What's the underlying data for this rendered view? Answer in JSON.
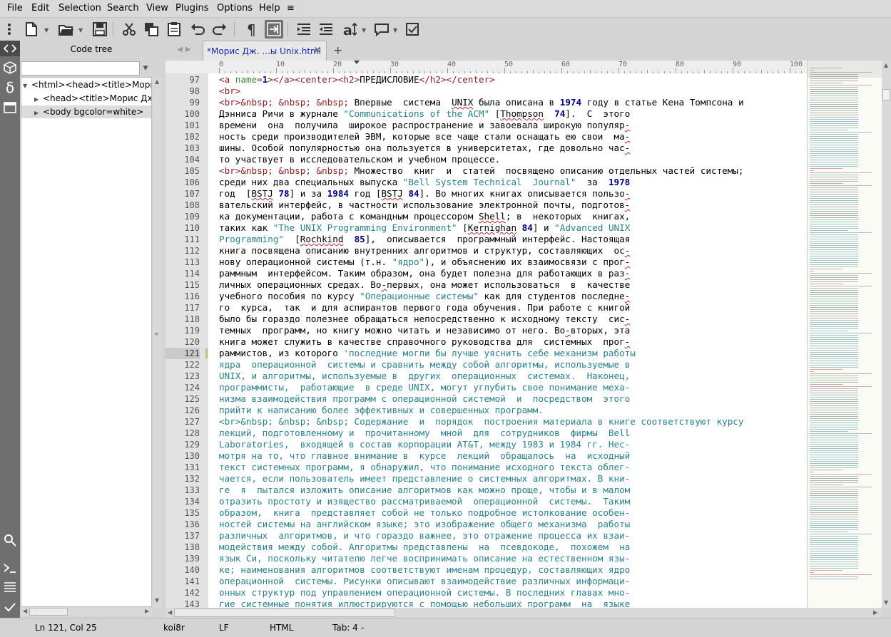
{
  "menu": [
    "File",
    "Edit",
    "Selection",
    "Search",
    "View",
    "Plugins",
    "Options",
    "Help",
    "≡"
  ],
  "sidebar": {
    "title": "Code tree",
    "filter_value": "",
    "tree": [
      {
        "label": "<html><head><title>Морис Дж",
        "expanded": true
      },
      {
        "label": "<head><title>Морис Дж. Ба",
        "expanded": false
      },
      {
        "label": "<body bgcolor=white>",
        "expanded": false
      }
    ]
  },
  "tab": {
    "label": "*Морис Дж. ...ы Unix.html",
    "close": "✕",
    "new": "+"
  },
  "ruler": [
    "0",
    "10",
    "20",
    "30",
    "40",
    "50",
    "60",
    "70",
    "80",
    "90",
    "100"
  ],
  "editor": {
    "first_line": 97,
    "current_line": 121,
    "lines": [
      [
        [
          "tag",
          "<a "
        ],
        [
          "attr",
          "name"
        ],
        [
          "tag",
          "="
        ],
        [
          "num",
          "1"
        ],
        [
          "tag",
          "></a><center><h2>"
        ],
        [
          "t",
          "ПРЕДИСЛОВИЕ"
        ],
        [
          "tag",
          "</h2></center>"
        ]
      ],
      [
        [
          "tag",
          "<br>"
        ]
      ],
      [
        [
          "tag",
          "<br>"
        ],
        [
          "ent",
          "&nbsp; &nbsp; &nbsp;"
        ],
        [
          "t",
          " Впервые  система  "
        ],
        [
          "sp",
          "UNIX"
        ],
        [
          "t",
          " была описана в "
        ],
        [
          "num",
          "1974"
        ],
        [
          "t",
          " году в статье Кена Томпсона и"
        ]
      ],
      [
        [
          "t",
          "Дэнниса Ричи в журнале "
        ],
        [
          "str",
          "\"Communications of the ACM\""
        ],
        [
          "t",
          " ["
        ],
        [
          "sp",
          "Thompson"
        ],
        [
          "t",
          "  "
        ],
        [
          "num",
          "74"
        ],
        [
          "t",
          "].  С  этого"
        ]
      ],
      [
        [
          "t",
          "времени  она  получила  широкое распространение и завоевала широкую популяр"
        ],
        [
          "sp",
          "-"
        ]
      ],
      [
        [
          "t",
          "ность среди производителей ЭВМ, которые все чаще стали оснащать ею свои  ма"
        ],
        [
          "sp",
          "-"
        ]
      ],
      [
        [
          "t",
          "шины. Особой популярностью она пользуется в университетах, где довольно час"
        ],
        [
          "sp",
          "-"
        ]
      ],
      [
        [
          "t",
          "то участвует в исследовательском и учебном процессе."
        ]
      ],
      [
        [
          "tag",
          "<br>"
        ],
        [
          "ent",
          "&nbsp; &nbsp; &nbsp;"
        ],
        [
          "t",
          " Множество  книг  и  статей  посвящено описанию отдельных частей системы;"
        ]
      ],
      [
        [
          "t",
          "среди них два специальных выпуска "
        ],
        [
          "str",
          "\"Bell System Technical  Journal\""
        ],
        [
          "t",
          "  за  "
        ],
        [
          "num",
          "1978"
        ]
      ],
      [
        [
          "t",
          "год  ["
        ],
        [
          "sp",
          "BSTJ"
        ],
        [
          "t",
          " "
        ],
        [
          "num",
          "78"
        ],
        [
          "t",
          "] и за "
        ],
        [
          "num",
          "1984"
        ],
        [
          "t",
          " год ["
        ],
        [
          "sp",
          "BSTJ"
        ],
        [
          "t",
          " "
        ],
        [
          "num",
          "84"
        ],
        [
          "t",
          "]. Во многих книгах описывается пользо"
        ],
        [
          "sp",
          "-"
        ]
      ],
      [
        [
          "t",
          "вательский интерфейс, в частности использование электронной почты, подготов"
        ],
        [
          "sp",
          "-"
        ]
      ],
      [
        [
          "t",
          "ка документации, работа с командным процессором "
        ],
        [
          "sp",
          "Shell"
        ],
        [
          "t",
          "; в  некоторых  книгах,"
        ]
      ],
      [
        [
          "t",
          "таких как "
        ],
        [
          "str",
          "\"The UNIX Programming Environment\""
        ],
        [
          "t",
          " ["
        ],
        [
          "sp",
          "Kernighan"
        ],
        [
          "t",
          " "
        ],
        [
          "num",
          "84"
        ],
        [
          "t",
          "] и "
        ],
        [
          "str",
          "\"Advanced UNIX"
        ]
      ],
      [
        [
          "str",
          "Programming\""
        ],
        [
          "t",
          "  ["
        ],
        [
          "sp",
          "Rochkind"
        ],
        [
          "t",
          "  "
        ],
        [
          "num",
          "85"
        ],
        [
          "t",
          "],  описывается  программный интерфейс. Настоящая"
        ]
      ],
      [
        [
          "t",
          "книга посвящена описанию внутренних алгоритмов и структур, составляющих  ос"
        ],
        [
          "sp",
          "-"
        ]
      ],
      [
        [
          "t",
          "нову операционной системы (т.н. "
        ],
        [
          "str",
          "\"ядро\""
        ],
        [
          "t",
          "), и объяснению их взаимосвязи с прог"
        ],
        [
          "sp",
          "-"
        ]
      ],
      [
        [
          "t",
          "раммным  интерфейсом. Таким образом, она будет полезна для работающих в раз"
        ],
        [
          "sp",
          "-"
        ]
      ],
      [
        [
          "t",
          "личных операционных средах. Во"
        ],
        [
          "sp",
          "-"
        ],
        [
          "t",
          "первых, она может использоваться  в  качестве"
        ]
      ],
      [
        [
          "t",
          "учебного пособия по курсу "
        ],
        [
          "str",
          "\"Операционные системы\""
        ],
        [
          "t",
          " как для студентов последне"
        ],
        [
          "sp",
          "-"
        ]
      ],
      [
        [
          "t",
          "го  курса,  так  и для аспирантов первого года обучения. При работе с книгой"
        ]
      ],
      [
        [
          "t",
          "было бы гораздо полезнее обращаться непосредственно к исходному тексту  сис"
        ],
        [
          "sp",
          "-"
        ]
      ],
      [
        [
          "t",
          "темных  программ, но книгу можно читать и независимо от него. Во"
        ],
        [
          "sp",
          "-"
        ],
        [
          "t",
          "вторых, эта"
        ]
      ],
      [
        [
          "t",
          "книга может служить в качестве справочного руководства для  системных  прог"
        ],
        [
          "sp",
          "-"
        ]
      ],
      [
        [
          "t",
          "раммистов, из которого "
        ],
        [
          "str",
          "'последние могли бы лучше уяснить себе механизм работы"
        ]
      ],
      [
        [
          "str",
          "ядра  операционной  системы и сравнить между собой алгоритмы, используемые в"
        ]
      ],
      [
        [
          "str",
          "UNIX, и алгоритмы, используемые в  других  операционных  системах.  Наконец,"
        ]
      ],
      [
        [
          "str",
          "программисты,  работающие  в среде UNIX, могут углубить свое понимание меха-"
        ]
      ],
      [
        [
          "str",
          "низма взаимодействия программ с операционной системой  и  посредством  этого"
        ]
      ],
      [
        [
          "str",
          "прийти к написанию более эффективных и совершенных программ."
        ]
      ],
      [
        [
          "str",
          "<br>&nbsp; &nbsp; &nbsp; Содержание  и  порядок  построения материала в книге соответствуют курсу"
        ]
      ],
      [
        [
          "str",
          "лекций, подготовленному и  прочитанному  мной  для  сотрудников  фирмы  Bell"
        ]
      ],
      [
        [
          "str",
          "Laboratories,  входящей в состав корпорации AT&T, между 1983 и 1984 гг. Нес-"
        ]
      ],
      [
        [
          "str",
          "мотря на то, что главное внимание в  курсе  лекций  обращалось  на  исходный"
        ]
      ],
      [
        [
          "str",
          "текст системных программ, я обнаружил, что понимание исходного текста облег-"
        ]
      ],
      [
        [
          "str",
          "чается, если пользователь имеет представление о системных алгоритмах. В кни-"
        ]
      ],
      [
        [
          "str",
          "ге  я  пытался изложить описание алгоритмов как можно проще, чтобы и в малом"
        ]
      ],
      [
        [
          "str",
          "отразить простоту и изящество рассматриваемой  операционной  системы.  Таким"
        ]
      ],
      [
        [
          "str",
          "образом,  книга  представляет собой не только подробное истолкование особен-"
        ]
      ],
      [
        [
          "str",
          "ностей системы на английском языке; это изображение общего механизма  работы"
        ]
      ],
      [
        [
          "str",
          "различных  алгоритмов, и что гораздо важнее, это отражение процесса их взаи-"
        ]
      ],
      [
        [
          "str",
          "модействия между собой. Алгоритмы представлены  на  псевдокоде,  похожем  на"
        ]
      ],
      [
        [
          "str",
          "язык Си, поскольку читателю легче воспринимать описание на естественном язы-"
        ]
      ],
      [
        [
          "str",
          "ке; наименования алгоритмов соответствуют именам процедур, составляющих ядро"
        ]
      ],
      [
        [
          "str",
          "операционной  системы. Рисунки описывают взаимодействие различных информаци-"
        ]
      ],
      [
        [
          "str",
          "онных структур под управлением операционной системы. В последних главах мно-"
        ]
      ],
      [
        [
          "str",
          "гие системные понятия иллюстрируются с помощью небольших программ  на  языке"
        ]
      ]
    ]
  },
  "status": {
    "position": "Ln 121, Col 25",
    "encoding": "koi8r",
    "line_ending": "LF",
    "language": "HTML",
    "tab": "Tab: 4",
    "tab_dash": "-"
  }
}
